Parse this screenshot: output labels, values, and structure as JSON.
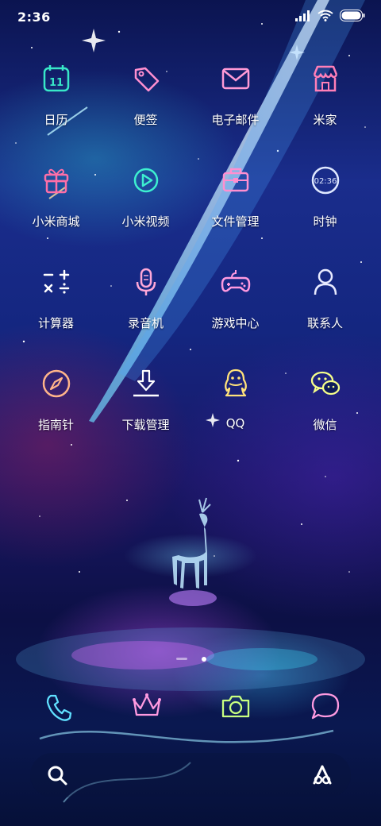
{
  "status_bar": {
    "time": "2:36"
  },
  "apps": [
    {
      "label": "日历",
      "icon": "calendar-icon",
      "color": "#38e8c8",
      "day": "11"
    },
    {
      "label": "便签",
      "icon": "tag-icon",
      "color": "#ff8fd0"
    },
    {
      "label": "电子邮件",
      "icon": "mail-icon",
      "color": "#ff9ad6"
    },
    {
      "label": "米家",
      "icon": "store-icon",
      "color": "#ff7fb8"
    },
    {
      "label": "小米商城",
      "icon": "gift-icon",
      "color": "#ff6fa8"
    },
    {
      "label": "小米视频",
      "icon": "play-icon",
      "color": "#3df0d0"
    },
    {
      "label": "文件管理",
      "icon": "briefcase-icon",
      "color": "#ff8fd0"
    },
    {
      "label": "时钟",
      "icon": "clock-icon",
      "color": "#dfe8ff",
      "clock_text": "02:36"
    },
    {
      "label": "计算器",
      "icon": "calculator-icon",
      "color": "#ffffff"
    },
    {
      "label": "录音机",
      "icon": "microphone-icon",
      "color": "#ffa8d8"
    },
    {
      "label": "游戏中心",
      "icon": "gamepad-icon",
      "color": "#ff9ae0"
    },
    {
      "label": "联系人",
      "icon": "person-icon",
      "color": "#e8eaff"
    },
    {
      "label": "指南针",
      "icon": "compass-icon",
      "color": "#ffb48a"
    },
    {
      "label": "下载管理",
      "icon": "download-icon",
      "color": "#ffffff"
    },
    {
      "label": "QQ",
      "icon": "qq-icon",
      "color": "#ffe27a"
    },
    {
      "label": "微信",
      "icon": "wechat-icon",
      "color": "#f6ff8a"
    }
  ],
  "dock": [
    {
      "icon": "phone-icon",
      "color": "#60e0ff"
    },
    {
      "icon": "crown-icon",
      "color": "#ff9ae0"
    },
    {
      "icon": "camera-icon",
      "color": "#c8ff80"
    },
    {
      "icon": "chat-bubble-icon",
      "color": "#ff9ae0"
    }
  ],
  "search_bar": {
    "left_icon": "search-icon",
    "right_icon": "assistant-icon"
  },
  "pager": {
    "count": 2,
    "active": 1
  }
}
